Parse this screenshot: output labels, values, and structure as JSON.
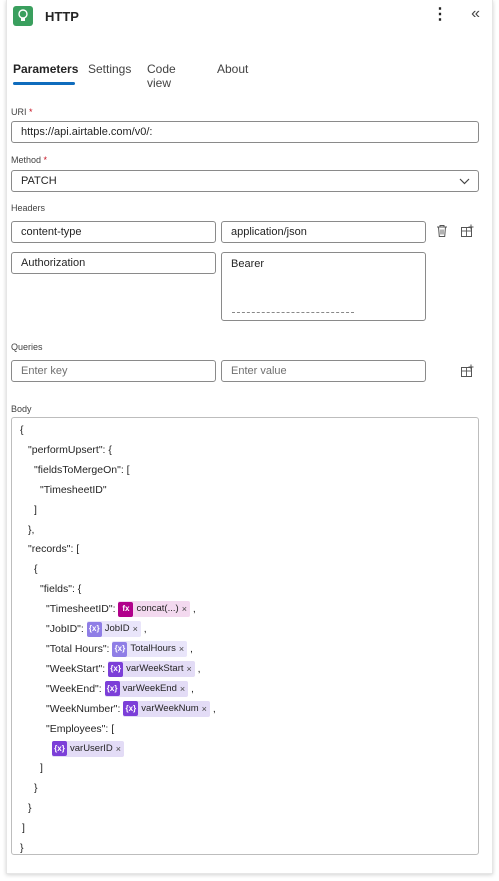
{
  "header": {
    "title": "HTTP",
    "more_glyph": "⋮",
    "collapse_glyph": "«"
  },
  "tabs": [
    {
      "label": "Parameters",
      "active": true
    },
    {
      "label": "Settings",
      "active": false
    },
    {
      "label": "Code view",
      "active": false
    },
    {
      "label": "About",
      "active": false
    }
  ],
  "uri": {
    "label": "URI",
    "required_mark": "*",
    "value": "https://api.airtable.com/v0/:"
  },
  "method": {
    "label": "Method",
    "required_mark": "*",
    "value": "PATCH"
  },
  "headers": {
    "label": "Headers",
    "rows": [
      {
        "key": "content-type",
        "value": "application/json"
      },
      {
        "key": "Authorization",
        "value": "Bearer"
      }
    ]
  },
  "queries": {
    "label": "Queries",
    "key_placeholder": "Enter key",
    "value_placeholder": "Enter value"
  },
  "body": {
    "label": "Body",
    "lines": [
      {
        "text": "{",
        "tokens": []
      },
      {
        "text": "\"performUpsert\": {",
        "tokens": []
      },
      {
        "text": "\"fieldsToMergeOn\": [",
        "tokens": []
      },
      {
        "text": "\"TimesheetID\"",
        "tokens": []
      },
      {
        "text": "]",
        "tokens": []
      },
      {
        "text": "},",
        "tokens": []
      },
      {
        "text": "\"records\": [",
        "tokens": []
      },
      {
        "text": "{",
        "tokens": []
      },
      {
        "text": "\"fields\": {",
        "tokens": []
      },
      {
        "text": "\"TimesheetID\":",
        "token": {
          "kind": "fx",
          "icon": "fx",
          "label": "concat(...)"
        },
        "suffix": ","
      },
      {
        "text": "\"JobID\":",
        "token": {
          "kind": "vl",
          "icon": "{x}",
          "label": "JobID"
        },
        "suffix": ","
      },
      {
        "text": "\"Total Hours\":",
        "token": {
          "kind": "vl",
          "icon": "{x}",
          "label": "TotalHours"
        },
        "suffix": ","
      },
      {
        "text": "\"WeekStart\":",
        "token": {
          "kind": "vr",
          "icon": "{x}",
          "label": "varWeekStart"
        },
        "suffix": ","
      },
      {
        "text": "\"WeekEnd\":",
        "token": {
          "kind": "vr",
          "icon": "{x}",
          "label": "varWeekEnd"
        },
        "suffix": ","
      },
      {
        "text": "\"WeekNumber\":",
        "token": {
          "kind": "vr",
          "icon": "{x}",
          "label": "varWeekNum"
        },
        "suffix": ","
      },
      {
        "text": "\"Employees\": [",
        "tokens": []
      },
      {
        "text": "",
        "token": {
          "kind": "vr",
          "icon": "{x}",
          "label": "varUserID"
        },
        "suffix": ""
      },
      {
        "text": "]",
        "tokens": []
      },
      {
        "text": "}",
        "tokens": []
      },
      {
        "text": "}",
        "tokens": []
      },
      {
        "text": "]",
        "tokens": []
      },
      {
        "text": "}",
        "tokens": []
      }
    ]
  },
  "icons": {
    "app": "lightbulb-icon",
    "delete": "trash-icon",
    "add": "add-row-icon",
    "close_token": "×"
  }
}
